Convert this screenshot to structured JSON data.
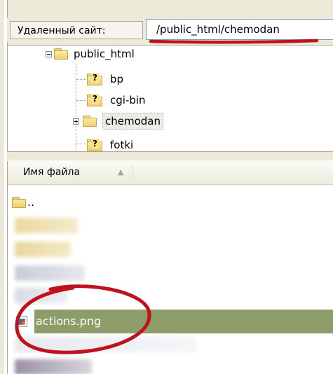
{
  "remote_site": {
    "label": "Удаленный сайт:",
    "path": "/public_html/chemodan"
  },
  "tree": {
    "root": "public_html",
    "children": [
      "bp",
      "cgi-bin",
      "chemodan",
      "fotki"
    ],
    "selected": "chemodan"
  },
  "file_list": {
    "column_header": "Имя файла",
    "sort_indicator": "▲",
    "parent_dir": "..",
    "selected_file": "actions.png"
  },
  "colors": {
    "selection": "#8d9d6a",
    "annotation_red": "#c0121a"
  }
}
